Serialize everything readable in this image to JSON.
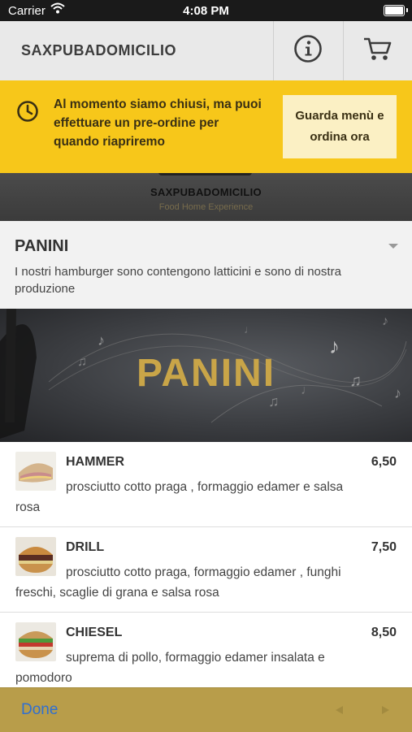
{
  "status_bar": {
    "carrier": "Carrier",
    "time": "4:08 PM"
  },
  "nav": {
    "title": "SAXPUBADOMICILIO",
    "info_icon": "info-icon",
    "cart_icon": "cart-icon"
  },
  "hero": {
    "brand": "SAXPUBADOMICILIO",
    "tagline": "Food Home Experience"
  },
  "closed_banner": {
    "message": "Al momento siamo chiusi, ma puoi effettuare un pre-ordine per quando riapriremo",
    "button_label": "Guarda menù e ordina ora",
    "icon": "clock-icon"
  },
  "section": {
    "title": "PANINI",
    "description": "I nostri hamburger sono contengono latticini e sono di nostra produzione",
    "banner_title": "PANINI"
  },
  "items": [
    {
      "name": "HAMMER",
      "price": "6,50",
      "description": "prosciutto cotto praga , formaggio edamer e salsa rosa"
    },
    {
      "name": "DRILL",
      "price": "7,50",
      "description": "prosciutto cotto praga, formaggio edamer , funghi freschi, scaglie di grana e salsa rosa"
    },
    {
      "name": "CHIESEL",
      "price": "8,50",
      "description": "suprema di pollo, formaggio edamer insalata e pomodoro"
    }
  ],
  "toolbar": {
    "done_label": "Done"
  },
  "colors": {
    "banner_yellow": "#f7c71a",
    "banner_button": "#fbf0c4",
    "gold": "#c9a548",
    "toolbar": "#b89d4a",
    "link_blue": "#2f6fd1"
  }
}
